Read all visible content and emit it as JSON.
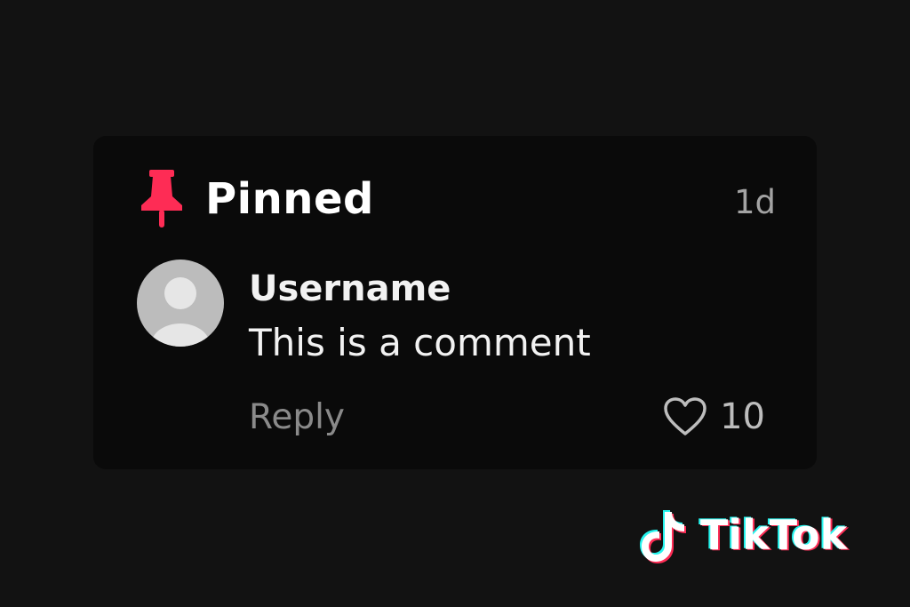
{
  "comment": {
    "pinned_label": "Pinned",
    "timestamp": "1d",
    "username": "Username",
    "text": "This is a comment",
    "reply_label": "Reply",
    "like_count": "10"
  },
  "branding": {
    "name": "TikTok"
  },
  "icons": {
    "pin": "pushpin-icon",
    "like": "heart-outline-icon",
    "avatar": "default-avatar-icon",
    "logo": "tiktok-note-icon"
  },
  "colors": {
    "background": "#121212",
    "card": "#0a0a0a",
    "pin": "#fe2c55",
    "brand_cyan": "#25f4ee",
    "brand_red": "#fe2c55"
  }
}
